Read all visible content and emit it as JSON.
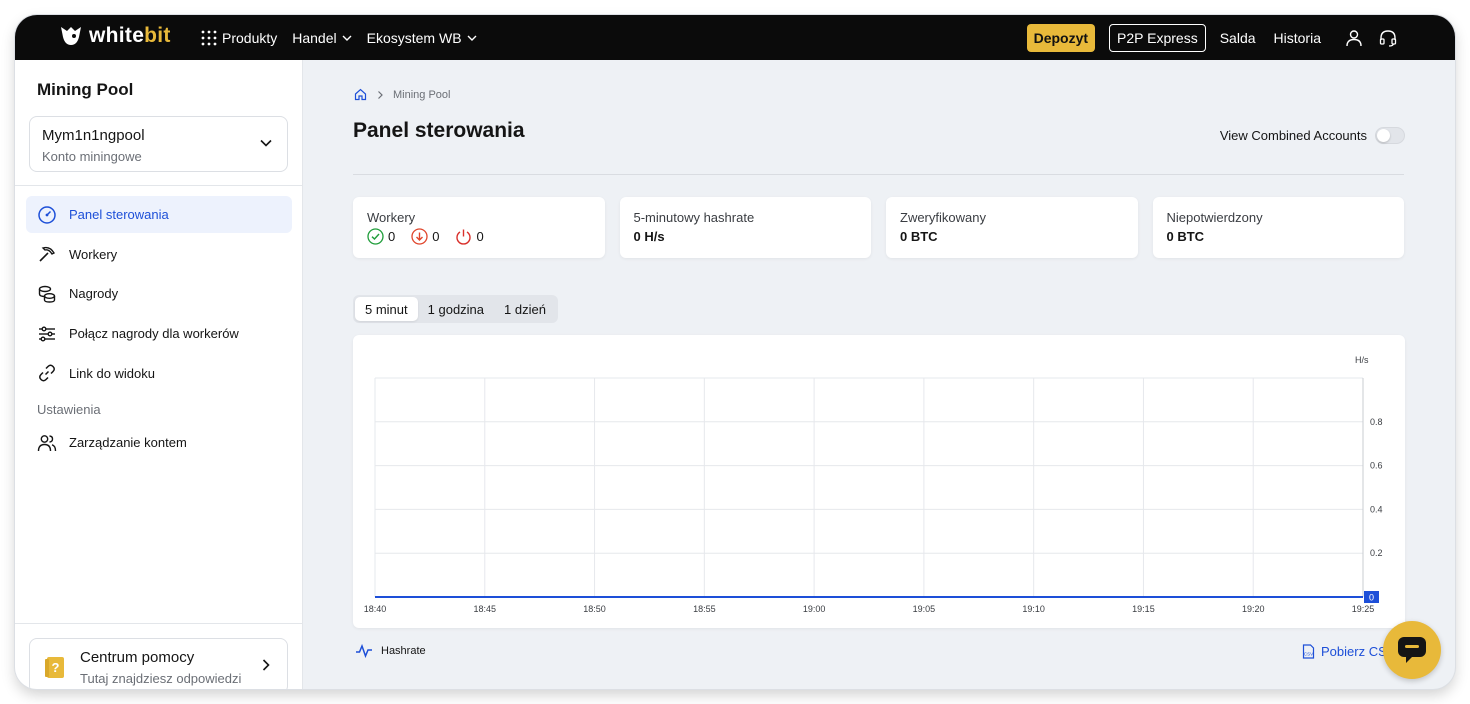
{
  "brand": {
    "logo_white": "white",
    "logo_bit": "bit"
  },
  "topnav": {
    "items": [
      {
        "label": "Produkty"
      },
      {
        "label": "Handel"
      },
      {
        "label": "Ekosystem WB"
      }
    ],
    "deposit": "Depozyt",
    "p2p": "P2P Express",
    "balances": "Salda",
    "history": "Historia"
  },
  "sidebar": {
    "title": "Mining Pool",
    "account_name": "Mym1n1ngpool",
    "account_sub": "Konto miningowe",
    "items": [
      {
        "label": "Panel sterowania",
        "icon": "dashboard-icon"
      },
      {
        "label": "Workery",
        "icon": "pickaxe-icon"
      },
      {
        "label": "Nagrody",
        "icon": "coins-icon"
      },
      {
        "label": "Połącz nagrody dla workerów",
        "icon": "sliders-icon"
      },
      {
        "label": "Link do widoku",
        "icon": "link-icon"
      }
    ],
    "settings_section": "Ustawienia",
    "settings_items": [
      {
        "label": "Zarządzanie kontem",
        "icon": "users-icon"
      }
    ],
    "help_title": "Centrum pomocy",
    "help_sub": "Tutaj znajdziesz odpowiedzi"
  },
  "main": {
    "breadcrumb": "Mining Pool",
    "title": "Panel sterowania",
    "combined_label": "View Combined Accounts",
    "cards": {
      "workers_label": "Workery",
      "workers_online": "0",
      "workers_offline": "0",
      "workers_dead": "0",
      "hashrate_label": "5-minutowy hashrate",
      "hashrate_value": "0 H/s",
      "verified_label": "Zweryfikowany",
      "verified_value": "0 BTC",
      "unconfirmed_label": "Niepotwierdzony",
      "unconfirmed_value": "0 BTC"
    },
    "tabs": [
      "5 minut",
      "1 godzina",
      "1 dzień"
    ],
    "legend": "Hashrate",
    "download": "Pobierz CSV"
  },
  "chart_data": {
    "type": "line",
    "x": [
      "18:40",
      "18:45",
      "18:50",
      "18:55",
      "19:00",
      "19:05",
      "19:10",
      "19:15",
      "19:20",
      "19:25"
    ],
    "series": [
      {
        "name": "Hashrate",
        "values": [
          0,
          0,
          0,
          0,
          0,
          0,
          0,
          0,
          0,
          0
        ]
      }
    ],
    "ylabel": "H/s",
    "y_ticks": [
      "0.2",
      "0.4",
      "0.6",
      "0.8"
    ],
    "ylim": [
      0,
      1
    ],
    "current_value_label": "0",
    "line_color": "#1d4fd8",
    "grid": true
  },
  "colors": {
    "accent": "#e8b93a",
    "link": "#1d4fd8",
    "online": "#1f9d3a",
    "offline": "#e0452b",
    "dead": "#d9302b"
  }
}
